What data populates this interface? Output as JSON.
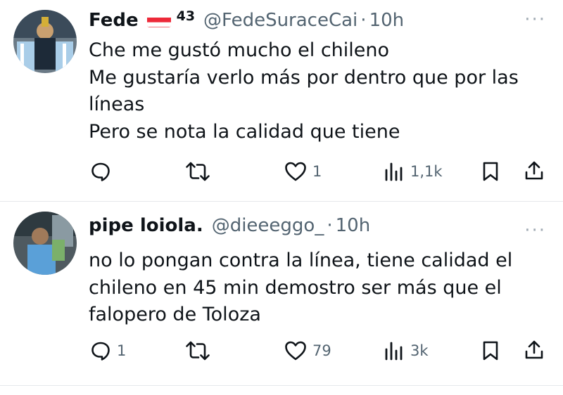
{
  "tweets": [
    {
      "name": "Fede",
      "badge": "43",
      "handle": "@FedeSuraceCai",
      "separator": "·",
      "time": "10h",
      "text": "Che me gustó mucho el chileno\nMe gustaría verlo más por dentro que por las\nlíneas\nPero se nota la calidad que tiene",
      "replies": "",
      "retweets": "",
      "likes": "1",
      "views": "1,1k",
      "flag_icon": "austria-flag-icon"
    },
    {
      "name": "pipe loiola.",
      "handle": "@dieeeggo_",
      "separator": "·",
      "time": "10h",
      "text": "no lo pongan contra la línea, tiene calidad el\nchileno en 45 min demostro ser más que el\nfalopero de Toloza",
      "replies": "1",
      "retweets": "",
      "likes": "79",
      "views": "3k"
    }
  ],
  "more_label": "···",
  "colors": {
    "text": "#0f1419",
    "secondary": "#536471",
    "divider": "#e6e8eb"
  }
}
